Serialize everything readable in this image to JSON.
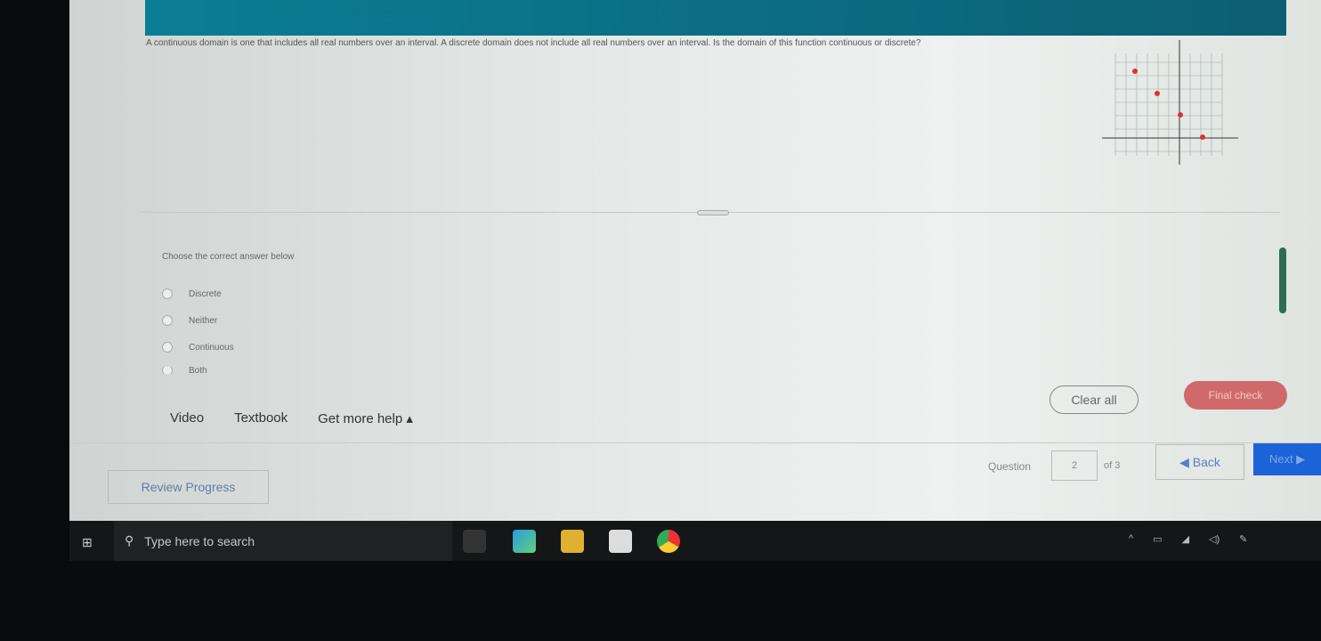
{
  "question": {
    "text": "A continuous domain is one that includes all real numbers over an interval. A discrete domain does not include all real numbers over an interval. Is the domain of this function continuous or discrete?"
  },
  "prompt": "Choose the correct answer below",
  "options": [
    {
      "label": "Discrete"
    },
    {
      "label": "Neither"
    },
    {
      "label": "Continuous"
    },
    {
      "label": "Both"
    }
  ],
  "help_links": {
    "video": "Video",
    "textbook": "Textbook",
    "more_help": "Get more help ▴"
  },
  "buttons": {
    "clear_all": "Clear all",
    "final_check": "Final check",
    "review_progress": "Review Progress",
    "back": "◀ Back",
    "next": "Next ▶"
  },
  "navigation": {
    "question_label": "Question",
    "question_number": "2",
    "of_total": "of 3"
  },
  "taskbar": {
    "search_placeholder": "Type here to search"
  },
  "colors": {
    "header": "#0a7d95",
    "next": "#1b63d6",
    "final_check": "#d06a6a",
    "points": "#d33"
  }
}
